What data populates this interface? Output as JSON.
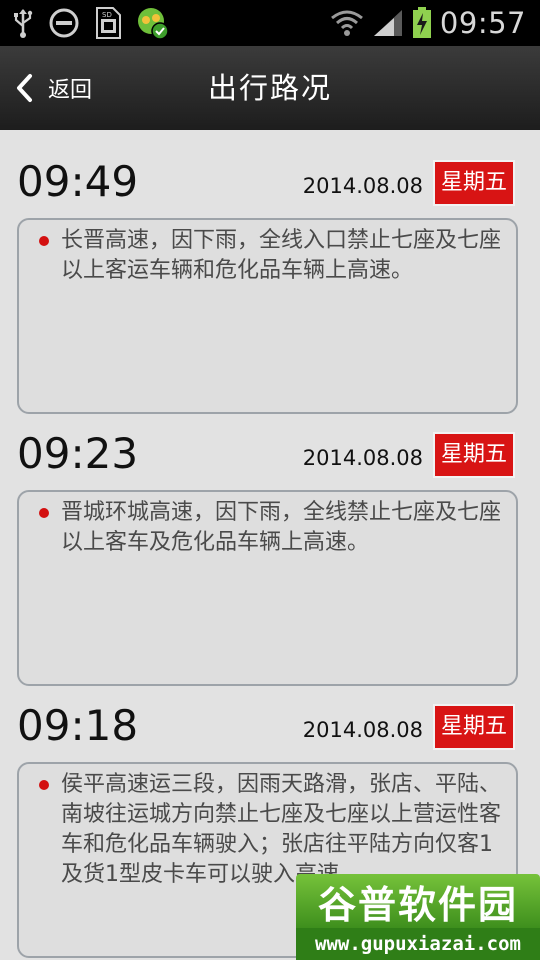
{
  "status_bar": {
    "time": "09:57",
    "left_icons": [
      "usb-icon",
      "do-not-disturb-icon",
      "sim-card-icon",
      "app-notification-icon"
    ],
    "right_icons": [
      "wifi-icon",
      "signal-icon",
      "battery-charging-icon"
    ]
  },
  "header": {
    "back_label": "返回",
    "title": "出行路况"
  },
  "entries": [
    {
      "time": "09:49",
      "date": "2014.08.08",
      "weekday": "星期五",
      "message": "长晋高速，因下雨，全线入口禁止七座及七座以上客运车辆和危化品车辆上高速。"
    },
    {
      "time": "09:23",
      "date": "2014.08.08",
      "weekday": "星期五",
      "message": "晋城环城高速，因下雨，全线禁止七座及七座以上客车及危化品车辆上高速。"
    },
    {
      "time": "09:18",
      "date": "2014.08.08",
      "weekday": "星期五",
      "message": "侯平高速运三段，因雨天路滑，张店、平陆、南坡往运城方向禁止七座及七座以上营运性客车和危化品车辆驶入；张店往平陆方向仅客1及货1型皮卡车可以驶入高速。"
    }
  ],
  "watermark": {
    "name": "谷普软件园",
    "url": "www.gupuxiazai.com"
  },
  "colors": {
    "weekday_badge": "#d81414",
    "bullet": "#d31010",
    "background": "#e2e2e2"
  }
}
